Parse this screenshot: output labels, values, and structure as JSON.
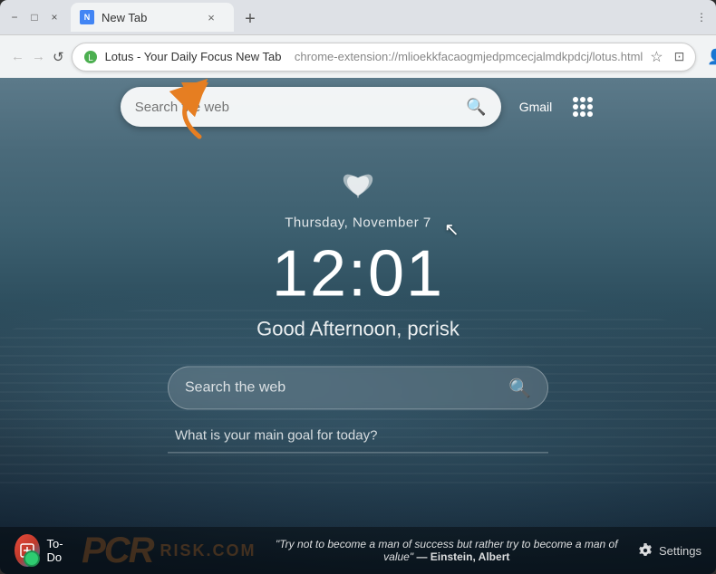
{
  "browser": {
    "title": "New Tab",
    "tab_label": "New Tab",
    "url_display": "Lotus - Your Daily Focus New Tab",
    "url_full": "chrome-extension://mlioekkfacaogmjedpmcecjalmdkpdcj/lotus.html",
    "nav": {
      "back_label": "←",
      "forward_label": "→",
      "refresh_label": "↺"
    },
    "controls": {
      "minimize": "−",
      "maximize": "□",
      "close": "×"
    },
    "toolbar": {
      "gmail": "Gmail",
      "new_tab_plus": "+"
    }
  },
  "page": {
    "app_name": "Lotus Daily Focus",
    "top_search_placeholder": "Search the web",
    "lotus_symbol": "✿",
    "date": "Thursday, November 7",
    "time": "12:01",
    "greeting": "Good Afternoon, pcrisk",
    "main_search_placeholder": "Search the web",
    "goal_label": "What is your main goal for today?",
    "bottom": {
      "todo_label": "To-Do",
      "quote": "\"Try not to become a man of success but rather try to become a man of value\"",
      "quote_author": "— Einstein, Albert",
      "settings_label": "Settings"
    }
  }
}
